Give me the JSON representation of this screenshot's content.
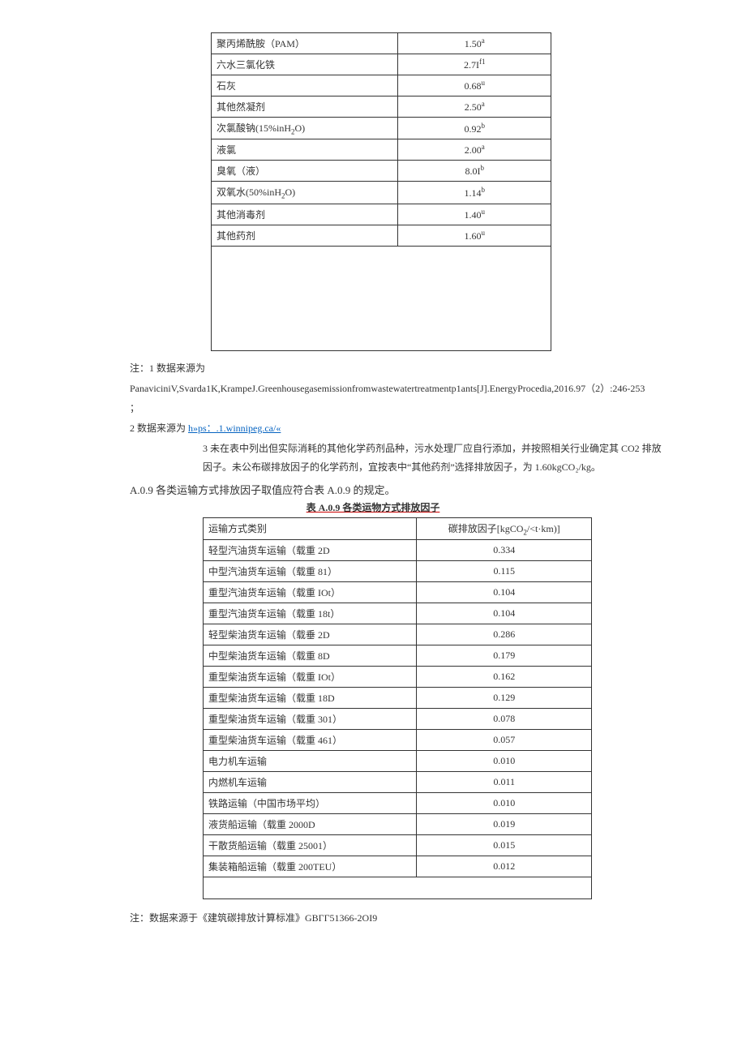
{
  "table1": {
    "rows": [
      {
        "name": "聚丙烯酰胺（PAM）",
        "val": "1.50",
        "sup": "a"
      },
      {
        "name": "六水三氯化铁",
        "val": "2.7I",
        "sup": "f1"
      },
      {
        "name": "石灰",
        "val": "0.68",
        "sup": "u"
      },
      {
        "name": "其他然凝剂",
        "val": "2.50",
        "sup": "a"
      },
      {
        "name_pre": "次氯酸钠(15%inH",
        "name_sub": "2",
        "name_post": "O)",
        "val": "0.92",
        "sup": "b"
      },
      {
        "name": "液氯",
        "val": "2.00",
        "sup": "a"
      },
      {
        "name": "臭氧（液）",
        "val": "8.0I",
        "sup": "b"
      },
      {
        "name_pre": "双氧水(50%inH",
        "name_sub": "2",
        "name_post": "O)",
        "val": "1.14",
        "sup": "b"
      },
      {
        "name": "其他消毒剂",
        "val": "1.40",
        "sup": "u"
      },
      {
        "name": "其他药剂",
        "val": "1.60",
        "sup": "u"
      }
    ]
  },
  "notes1": {
    "n1_label": "注：1 数据来源为",
    "n1_text": "PanaviciniV,Svarda1K,KrampeJ.Greenhousegasemissionfromwastewatertreatmentp1ants[J].EnergyProcedia,2016.97（2）:246-253",
    "n1_tail": "；",
    "n2_label": "2 数据来源为 ",
    "n2_link": "h»ps：.1.winnipeg.ca/«",
    "n3": "3 未在表中列出但实际消耗的其他化学药剂品种，污水处理厂应自行添加，并按照相关行业确定其 CO2 排放因子。未公布碳排放因子的化学药剂，宜按表中“其他药剂”选择排放因子，为 1.60kgCO₂/kg。"
  },
  "section": {
    "line": "A.0.9 各类运输方式排放因子取值应符合表 A.0.9 的规定。",
    "title": "表 A.0.9 各类运物方式排放因子"
  },
  "table2": {
    "h1": "运输方式类别",
    "h2_pre": "碳排放因子[kgCO",
    "h2_sub": "2",
    "h2_post": "/<t·km)]",
    "rows": [
      {
        "name": "轻型汽油货车运输（载重 2D",
        "val": "0.334"
      },
      {
        "name": "中型汽油货车运输（载重 81）",
        "val": "0.115"
      },
      {
        "name": "重型汽油货车运输（载重 IOt）",
        "val": "0.104"
      },
      {
        "name": "重型汽油货车运输（载重 18t）",
        "val": "0.104"
      },
      {
        "name": "轻型柴油货车运输（载垂 2D",
        "val": "0.286"
      },
      {
        "name": "中型柴油货车运输（载重 8D",
        "val": "0.179"
      },
      {
        "name": "重型柴油货车运输（载重 IOt）",
        "val": "0.162"
      },
      {
        "name": "重型柴油货车运输（载重 18D",
        "val": "0.129"
      },
      {
        "name": "重型柴油货车运输（载重 301）",
        "val": "0.078"
      },
      {
        "name": "重型柴油货车运输（载重 461）",
        "val": "0.057"
      },
      {
        "name": "电力机车运输",
        "val": "0.010"
      },
      {
        "name": "内燃机车运输",
        "val": "0.011"
      },
      {
        "name": "铁路运输（中国市场平均）",
        "val": "0.010"
      },
      {
        "name": "液货船运输（载重 2000D",
        "val": "0.019"
      },
      {
        "name": "干散货船运输（载重 25001）",
        "val": "0.015"
      },
      {
        "name": "集装箱船运输（载重 200TEU）",
        "val": "0.012"
      }
    ]
  },
  "footnote": "注：数据来源于《建筑碳排放计算标准》GBГГ51366-2OI9"
}
